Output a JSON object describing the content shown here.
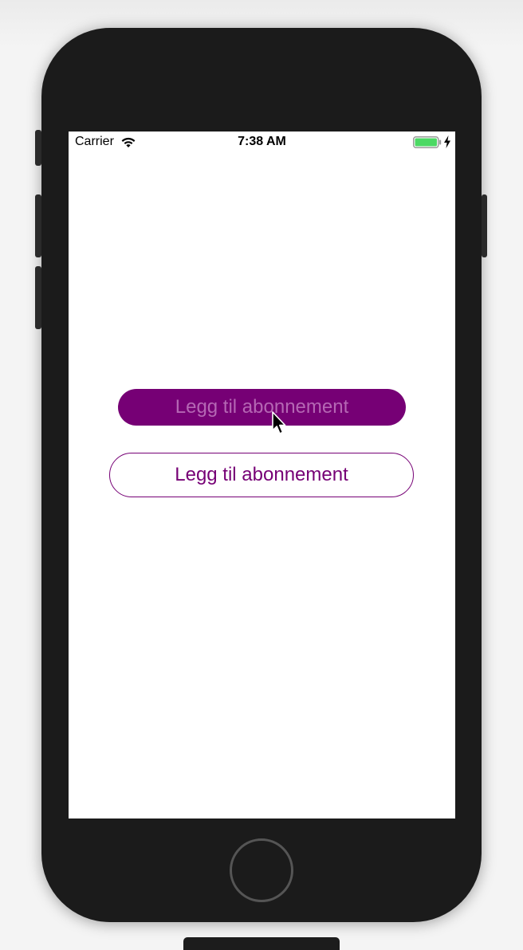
{
  "status_bar": {
    "carrier": "Carrier",
    "time": "7:38 AM",
    "battery_level": 1.0,
    "battery_color": "#4cd964"
  },
  "main": {
    "primary_button_label": "Legg til abonnement",
    "secondary_button_label": "Legg til abonnement"
  },
  "colors": {
    "accent": "#760075",
    "primary_label": "#b567b4",
    "screen_background": "#ffffff",
    "device_body": "#1b1b1b"
  },
  "icons": {
    "wifi": "wifi-icon",
    "battery": "battery-icon",
    "charging": "charging-bolt-icon",
    "cursor": "mouse-pointer-icon",
    "home": "home-button"
  }
}
